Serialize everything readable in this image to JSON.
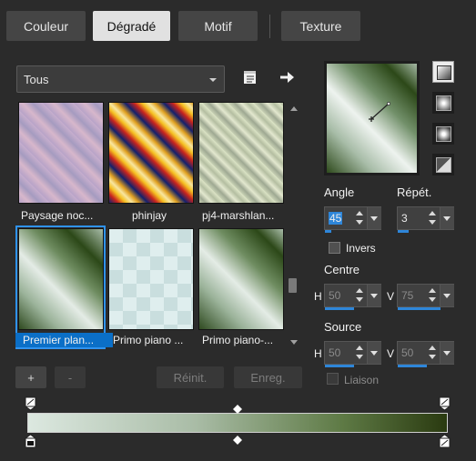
{
  "tabs": [
    {
      "label": "Couleur",
      "active": false
    },
    {
      "label": "Dégradé",
      "active": true
    },
    {
      "label": "Motif",
      "active": false
    },
    {
      "label": "Texture",
      "active": false
    }
  ],
  "filter": {
    "selected": "Tous"
  },
  "gallery": {
    "items": [
      {
        "caption": "Paysage noc...",
        "selected": false
      },
      {
        "caption": "phinjay",
        "selected": false
      },
      {
        "caption": "pj4-marshlan...",
        "selected": false
      },
      {
        "caption": "Premier plan...",
        "selected": true
      },
      {
        "caption": "Primo piano ...",
        "selected": false
      },
      {
        "caption": "Primo piano-...",
        "selected": false
      }
    ]
  },
  "buttons": {
    "add": "+",
    "remove": "-",
    "reset": "Réinit.",
    "save": "Enreg."
  },
  "angle": {
    "label": "Angle",
    "value": "45"
  },
  "repeat": {
    "label": "Répét.",
    "value": "3"
  },
  "invert": {
    "label": "Invers",
    "checked": false
  },
  "center": {
    "label": "Centre",
    "h_label": "H",
    "h": "50",
    "v_label": "V",
    "v": "75"
  },
  "source": {
    "label": "Source",
    "h_label": "H",
    "h": "50",
    "v_label": "V",
    "v": "50"
  },
  "link": {
    "label": "Liaison",
    "checked": false
  },
  "gradient": {
    "start": "#dce8e0",
    "end": "#2a3a10"
  },
  "icons": {
    "file": "file-list-icon",
    "arrow": "arrow-right-icon",
    "styles": [
      "linear-style-icon",
      "rectangular-style-icon",
      "sunburst-style-icon",
      "radial-style-icon"
    ]
  }
}
